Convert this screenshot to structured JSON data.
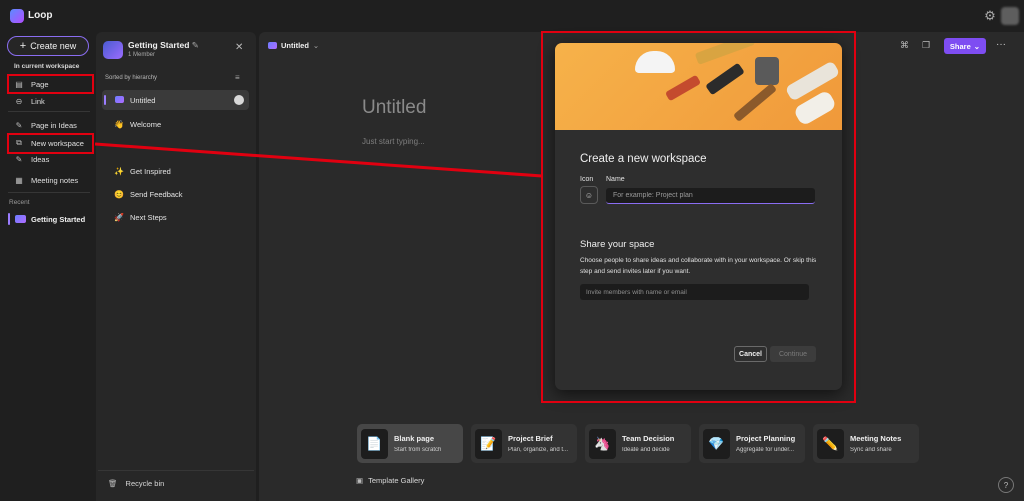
{
  "app": {
    "name": "Loop"
  },
  "nav": {
    "create_label": "Create new",
    "dropdown_header": "In current workspace",
    "items": [
      {
        "label": "Page",
        "icon": "page-icon"
      },
      {
        "label": "Link",
        "icon": "link-icon"
      },
      {
        "label": "Page in Ideas",
        "icon": "pencil-icon"
      },
      {
        "label": "New workspace",
        "icon": "workspace-icon"
      },
      {
        "label": "Ideas",
        "icon": "pencil-icon"
      },
      {
        "label": "Meeting notes",
        "icon": "notes-icon"
      }
    ],
    "recent_label": "Recent",
    "recent_item": "Getting Started"
  },
  "workspace": {
    "title": "Getting Started",
    "members": "1 Member",
    "sorted_label": "Sorted by hierarchy",
    "items": [
      {
        "label": "Untitled",
        "emoji": ""
      },
      {
        "label": "Welcome",
        "emoji": "👋"
      },
      {
        "label": "Get Inspired",
        "emoji": "✨"
      },
      {
        "label": "Send Feedback",
        "emoji": "😊"
      },
      {
        "label": "Next Steps",
        "emoji": "🚀"
      }
    ],
    "recycle_label": "Recycle bin"
  },
  "editor": {
    "tab_title": "Untitled",
    "share_label": "Share",
    "page_title": "Untitled",
    "hint": "Just start typing..."
  },
  "templates": [
    {
      "title": "Blank page",
      "subtitle": "Start from scratch",
      "icon": "📄"
    },
    {
      "title": "Project Brief",
      "subtitle": "Plan, organize, and t...",
      "icon": "📝"
    },
    {
      "title": "Team Decision",
      "subtitle": "Ideate and decide",
      "icon": "🦄"
    },
    {
      "title": "Project Planning",
      "subtitle": "Aggregate for under...",
      "icon": "💎"
    },
    {
      "title": "Meeting Notes",
      "subtitle": "Sync and share",
      "icon": "✏️"
    }
  ],
  "template_gallery_label": "Template Gallery",
  "modal": {
    "title": "Create a new workspace",
    "icon_label": "Icon",
    "name_label": "Name",
    "name_placeholder": "For example: Project plan",
    "share_title": "Share your space",
    "share_desc": "Choose people to share ideas and collaborate with in your workspace. Or skip this step and send invites later if you want.",
    "invite_placeholder": "Invite members with name or email",
    "cancel_label": "Cancel",
    "continue_label": "Continue"
  },
  "colors": {
    "accent": "#7e4df2",
    "annotation": "#e10010",
    "background": "#1f1f1f"
  }
}
